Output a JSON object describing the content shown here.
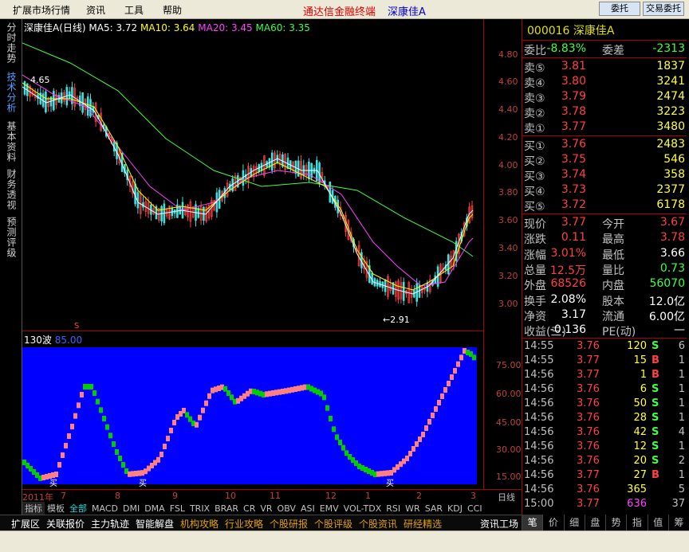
{
  "menu": {
    "items": [
      "扩展市场行情",
      "资讯",
      "工具",
      "帮助"
    ],
    "app_title": "通达信金融终端",
    "stock_title": "深康佳A",
    "win_btns": [
      "委托",
      "交易委托"
    ]
  },
  "left_tabs": [
    "分时走势",
    "技术分析",
    "基本资料",
    "财务透视",
    "预测评级"
  ],
  "kline": {
    "name": "深康佳A",
    "period": "(日线)",
    "ma5": "MA5: 3.72",
    "ma10": "MA10: 3.64",
    "ma20": "MA20: 3.45",
    "ma60": "MA60: 3.35",
    "hi_label": "4.65",
    "lo_label": "←2.91",
    "s_marker": "S"
  },
  "price_axis": [
    "4.80",
    "4.60",
    "4.40",
    "4.20",
    "4.00",
    "3.80",
    "3.60",
    "3.40",
    "3.20",
    "3.00"
  ],
  "indicator": {
    "name": "130波",
    "value": "85.00",
    "axis": [
      "75.00",
      "60.00",
      "45.00",
      "30.00",
      "15.00"
    ],
    "buy_label": "买"
  },
  "date_axis": {
    "labels": [
      "2011年",
      "7",
      "8",
      "9",
      "10",
      "11",
      "12",
      "1",
      "2",
      "3"
    ],
    "period": "日线"
  },
  "ind_tabs": [
    "指标",
    "模板",
    "全部",
    "MACD",
    "DMI",
    "DMA",
    "FSL",
    "TRIX",
    "BRAR",
    "CR",
    "VR",
    "OBV",
    "ASI",
    "EMV",
    "VOL-TDX",
    "RSI",
    "WR",
    "SAR",
    "KDJ",
    "CCI"
  ],
  "bottom_tabs": [
    "扩展区",
    "关联报价",
    "主力轨迹",
    "智能解盘",
    "机构攻略",
    "行业攻略",
    "个股研报",
    "个股评级",
    "个股资讯",
    "研经精选",
    "资讯工场"
  ],
  "rp_tabs": [
    "笔",
    "价",
    "细",
    "盘",
    "势",
    "指",
    "值",
    "筹"
  ],
  "quote": {
    "code": "000016 深康佳A",
    "weibi_label": "委比",
    "weibi": "-8.83%",
    "weicha_label": "委差",
    "weicha": "-2313",
    "sells": [
      {
        "l": "卖⑤",
        "p": "3.81",
        "v": "1837"
      },
      {
        "l": "卖④",
        "p": "3.80",
        "v": "3241"
      },
      {
        "l": "卖③",
        "p": "3.79",
        "v": "2474"
      },
      {
        "l": "卖②",
        "p": "3.78",
        "v": "3223"
      },
      {
        "l": "卖①",
        "p": "3.77",
        "v": "3480"
      }
    ],
    "buys": [
      {
        "l": "买①",
        "p": "3.76",
        "v": "2483"
      },
      {
        "l": "买②",
        "p": "3.75",
        "v": "546"
      },
      {
        "l": "买③",
        "p": "3.74",
        "v": "358"
      },
      {
        "l": "买④",
        "p": "3.73",
        "v": "2377"
      },
      {
        "l": "买⑤",
        "p": "3.72",
        "v": "6178"
      }
    ],
    "stats": [
      {
        "l1": "现价",
        "v1": "3.77",
        "l2": "今开",
        "v2": "3.67"
      },
      {
        "l1": "涨跌",
        "v1": "0.11",
        "l2": "最高",
        "v2": "3.78"
      },
      {
        "l1": "涨幅",
        "v1": "3.01%",
        "l2": "最低",
        "v2": "3.66"
      },
      {
        "l1": "总量",
        "v1": "12.5万",
        "l2": "量比",
        "v2": "0.73"
      },
      {
        "l1": "外盘",
        "v1": "68526",
        "l2": "内盘",
        "v2": "56070"
      },
      {
        "l1": "换手",
        "v1": "2.08%",
        "l2": "股本",
        "v2": "12.0亿"
      },
      {
        "l1": "净资",
        "v1": "3.17",
        "l2": "流通",
        "v2": "6.00亿"
      },
      {
        "l1": "收益(三)",
        "v1": "-0.136",
        "l2": "PE(动)",
        "v2": "—"
      }
    ],
    "ticks": [
      {
        "t": "14:55",
        "p": "3.76",
        "v": "120",
        "b": "S",
        "n": "6"
      },
      {
        "t": "14:55",
        "p": "3.77",
        "v": "15",
        "b": "B",
        "n": "1"
      },
      {
        "t": "14:56",
        "p": "3.77",
        "v": "1",
        "b": "B",
        "n": "1"
      },
      {
        "t": "14:56",
        "p": "3.76",
        "v": "6",
        "b": "S",
        "n": "1"
      },
      {
        "t": "14:56",
        "p": "3.76",
        "v": "50",
        "b": "S",
        "n": "1"
      },
      {
        "t": "14:56",
        "p": "3.76",
        "v": "28",
        "b": "S",
        "n": "1"
      },
      {
        "t": "14:56",
        "p": "3.76",
        "v": "42",
        "b": "S",
        "n": "4"
      },
      {
        "t": "14:56",
        "p": "3.76",
        "v": "12",
        "b": "S",
        "n": "1"
      },
      {
        "t": "14:56",
        "p": "3.76",
        "v": "20",
        "b": "S",
        "n": "2"
      },
      {
        "t": "14:56",
        "p": "3.77",
        "v": "27",
        "b": "B",
        "n": "1"
      },
      {
        "t": "14:56",
        "p": "3.76",
        "v": "365",
        "b": "",
        "n": "5"
      },
      {
        "t": "15:00",
        "p": "3.77",
        "v": "636",
        "b": "",
        "n": "37"
      }
    ]
  },
  "colors": {
    "up": "#ff4040",
    "down": "#40e0e0",
    "ma5": "#ffffff",
    "ma10": "#ffff00",
    "ma20": "#ff40ff",
    "ma60": "#40ff40",
    "ind_bg": "#0000ff",
    "ind_up": "#ff8080",
    "ind_down": "#00cc00"
  }
}
